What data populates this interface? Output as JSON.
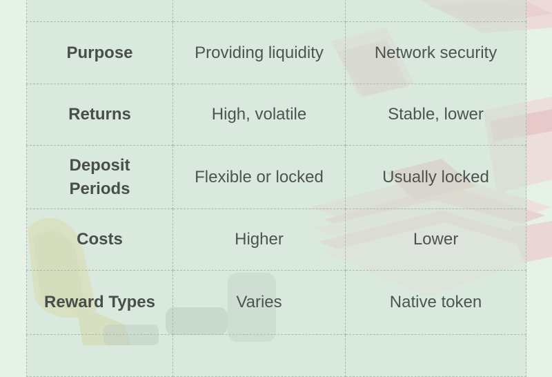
{
  "table": {
    "rows": [
      {
        "label": "Purpose",
        "farming": "Providing liquidity",
        "staking": "Network security"
      },
      {
        "label": "Returns",
        "farming": "High, volatile",
        "staking": "Stable, lower"
      },
      {
        "label_line1": "Deposit",
        "label_line2": "Periods",
        "farming": "Flexible or locked",
        "staking": "Usually locked"
      },
      {
        "label": "Costs",
        "farming": "Higher",
        "staking": "Lower"
      },
      {
        "label": "Reward Types",
        "farming": "Varies",
        "staking": "Native token"
      }
    ]
  },
  "colors": {
    "page_background": "#e6f1e8",
    "cell_background": "#cde2d4",
    "border": "#a9b9ad",
    "text": "#4f534f"
  },
  "icons": [
    "banknote-stack-illustration",
    "cash-bundle-illustration",
    "coin-pouch-illustration",
    "wallet-illustration"
  ]
}
